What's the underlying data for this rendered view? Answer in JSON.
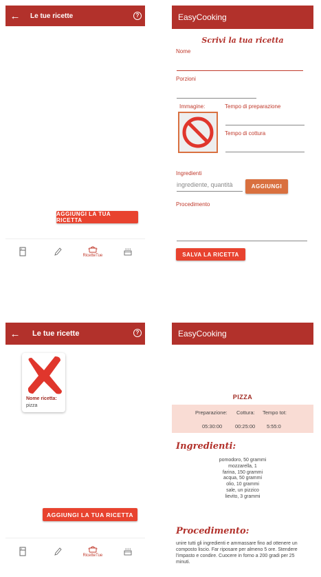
{
  "screen1": {
    "title": "Le tue ricette",
    "back_icon": "arrow-left",
    "help_icon": "question-circle",
    "help_glyph": "?",
    "add_button": "AGGIUNGI LA TUA RICETTA",
    "nav": [
      {
        "icon": "fridge-icon",
        "label": ""
      },
      {
        "icon": "pencil-icon",
        "label": ""
      },
      {
        "icon": "cooking-pot-icon",
        "label": "RicetteTue",
        "active": true
      },
      {
        "icon": "pan-icon",
        "label": ""
      }
    ]
  },
  "screen2": {
    "app_title": "EasyCooking",
    "heading": "Scrivi la tua ricetta",
    "name_label": "Nome",
    "portions_label": "Porzioni",
    "image_label": "Immagine:",
    "prep_label": "Tempo di preparazione",
    "cook_label": "Tempo di cottura",
    "ingredients_label": "Ingredienti",
    "ingredient_placeholder": "ingrediente, quantità",
    "add_ingredient_button": "AGGIUNGI",
    "procedure_label": "Procedimento",
    "save_button": "SALVA LA RICETTA"
  },
  "screen3": {
    "title": "Le tue ricette",
    "card_name_label": "Nome ricetta:",
    "card_name_value": "pizza",
    "add_button": "AGGIUNGI LA TUA RICETTA",
    "help_glyph": "?",
    "nav_active_label": "RicetteTue"
  },
  "screen4": {
    "app_title": "EasyCooking",
    "recipe_name": "PIZZA",
    "times": {
      "prep_label": "Preparazione:",
      "cook_label": "Cottura:",
      "total_label": "Tempo tot:",
      "prep_value": "05:30:00",
      "cook_value": "00:25:00",
      "total_value": "5:55:0"
    },
    "ingredients_title": "Ingredienti:",
    "ingredients": [
      "pomodoro, 50 grammi",
      "mozzarella, 1",
      "farina, 150 grammi",
      "acqua, 50 grammi",
      "olio, 10 grammi",
      "sale, un pizzico",
      "lievito, 3 grammi"
    ],
    "procedure_title": "Procedimento:",
    "procedure_text": "unire tutti gli ingredienti e ammassare fino ad ottenere un composto liscio. Far riposare per almeno 5 ore. Stendere l'impasto e condire. Cuocere in forno a 200 gradi per 25 minuti."
  },
  "colors": {
    "appbar": "#b2312b",
    "button_red": "#e8432f",
    "button_orange": "#d9703f",
    "times_bg": "#f9dcd4"
  }
}
